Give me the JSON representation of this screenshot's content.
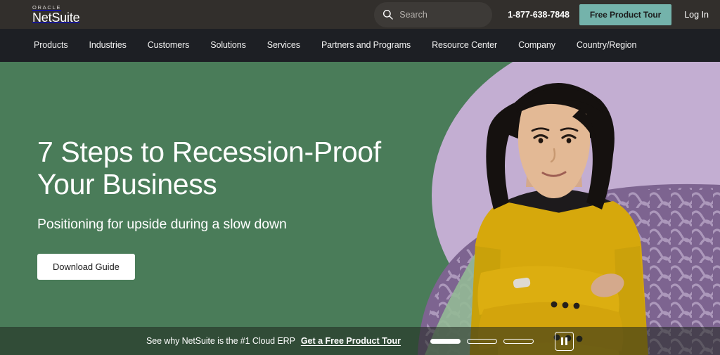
{
  "brand": {
    "oracle": "ORACLE",
    "netsuite": "NetSuite"
  },
  "topbar": {
    "search_placeholder": "Search",
    "search_value": "",
    "phone": "1-877-638-7848",
    "tour_label": "Free Product Tour",
    "login_label": "Log In",
    "tour_bg_color": "#74b3ab",
    "bar_bg_color": "#322f2c"
  },
  "nav": {
    "bg_color": "#1d1f24",
    "items": [
      {
        "label": "Products"
      },
      {
        "label": "Industries"
      },
      {
        "label": "Customers"
      },
      {
        "label": "Solutions"
      },
      {
        "label": "Services"
      },
      {
        "label": "Partners and Programs"
      },
      {
        "label": "Resource Center"
      },
      {
        "label": "Company"
      },
      {
        "label": "Country/Region"
      }
    ]
  },
  "hero": {
    "title": "7 Steps to Recession-Proof\nYour Business",
    "subtitle": "Positioning for upside during a slow down",
    "cta_label": "Download Guide",
    "green_color": "#4a7c59",
    "lavender_color": "#c3aed2",
    "purple_color": "#7d6490",
    "light_green_color": "#93b996",
    "blazer_color": "#d6a80c"
  },
  "promobar": {
    "text": "See why NetSuite is the #1 Cloud ERP",
    "link_label": "Get a Free Product Tour",
    "slides": [
      {
        "label": "Slide 1",
        "active": true
      },
      {
        "label": "Slide 2",
        "active": false
      },
      {
        "label": "Slide 3",
        "active": false
      }
    ],
    "pause_label": "Pause"
  }
}
